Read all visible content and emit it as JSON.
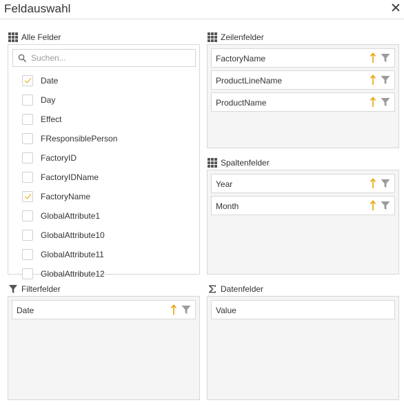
{
  "dialog": {
    "title": "Feldauswahl",
    "close_icon": "close-icon"
  },
  "colors": {
    "accent": "#e8a300",
    "panel_bg": "#f5f5f5",
    "border": "#d7d7d7",
    "filter_icon": "#9b9b9b"
  },
  "all_fields": {
    "header": "Alle Felder",
    "icon": "grid-icon",
    "search_placeholder": "Suchen...",
    "items": [
      {
        "label": "Date",
        "checked": true
      },
      {
        "label": "Day",
        "checked": false
      },
      {
        "label": "Effect",
        "checked": false
      },
      {
        "label": "FResponsiblePerson",
        "checked": false
      },
      {
        "label": "FactoryID",
        "checked": false
      },
      {
        "label": "FactoryIDName",
        "checked": false
      },
      {
        "label": "FactoryName",
        "checked": true
      },
      {
        "label": "GlobalAttribute1",
        "checked": false
      },
      {
        "label": "GlobalAttribute10",
        "checked": false
      },
      {
        "label": "GlobalAttribute11",
        "checked": false
      },
      {
        "label": "GlobalAttribute12",
        "checked": false
      }
    ]
  },
  "row_fields": {
    "header": "Zeilenfelder",
    "icon": "grid-icon",
    "items": [
      {
        "label": "FactoryName"
      },
      {
        "label": "ProductLineName"
      },
      {
        "label": "ProductName"
      }
    ]
  },
  "column_fields": {
    "header": "Spaltenfelder",
    "icon": "grid-icon",
    "items": [
      {
        "label": "Year"
      },
      {
        "label": "Month"
      }
    ]
  },
  "filter_fields": {
    "header": "Filterfelder",
    "icon": "funnel-icon",
    "items": [
      {
        "label": "Date"
      }
    ]
  },
  "data_fields": {
    "header": "Datenfelder",
    "icon": "sigma-icon",
    "items": [
      {
        "label": "Value"
      }
    ]
  }
}
